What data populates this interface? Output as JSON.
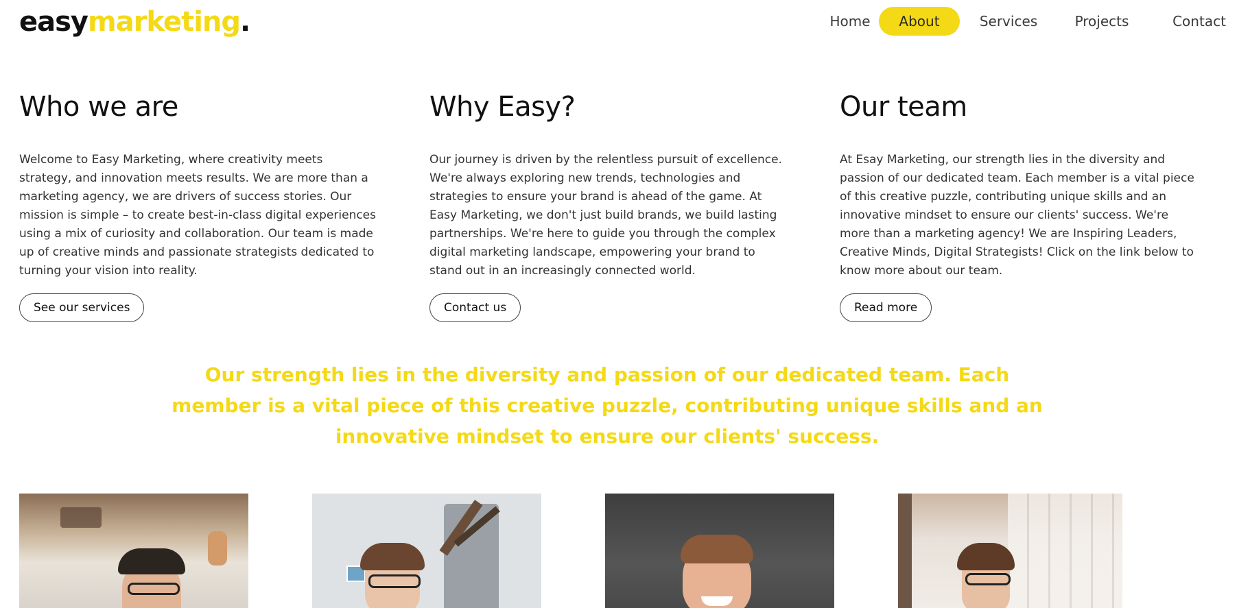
{
  "header": {
    "logo": {
      "part1": "easy",
      "part2": "marketing",
      "part3": "."
    },
    "nav": [
      {
        "label": "Home",
        "active": false
      },
      {
        "label": "About",
        "active": true
      },
      {
        "label": "Services",
        "active": false
      },
      {
        "label": "Projects",
        "active": false
      },
      {
        "label": "Contact",
        "active": false
      }
    ]
  },
  "columns": [
    {
      "title": "Who we are",
      "text": "Welcome to Easy Marketing, where creativity meets strategy, and innovation meets results. We are more than a marketing agency, we are drivers of success stories. Our mission is simple – to create best-in-class digital experiences using a mix of curiosity and collaboration. Our team is made up of creative minds and passionate strategists dedicated to turning your vision into reality.",
      "button": "See our services"
    },
    {
      "title": "Why Easy?",
      "text": "Our journey is driven by the relentless pursuit of excellence. We're always exploring new trends, technologies and strategies to ensure your brand is ahead of the game. At Easy Marketing, we don't just build brands, we build lasting partnerships. We're here to guide you through the complex digital marketing landscape, empowering your brand to stand out in an increasingly connected world.",
      "button": "Contact us"
    },
    {
      "title": "Our team",
      "text": "At Esay Marketing, our strength lies in the diversity and passion of our dedicated team. Each member is a vital piece of this creative puzzle, contributing unique skills and an innovative mindset to ensure our clients' success. We're more than a marketing agency! We are Inspiring Leaders, Creative Minds, Digital Strategists! Click on the link below to know more about our team.",
      "button": "Read more"
    }
  ],
  "quote": "Our strength lies in the diversity and passion of our dedicated team. Each member is a vital piece of this creative puzzle, contributing unique skills and an innovative mindset to ensure our clients' success.",
  "colors": {
    "accent": "#f4d916",
    "text": "#333333",
    "heading": "#111111"
  },
  "team_photos": [
    {
      "icon": "team-member-photo"
    },
    {
      "icon": "team-member-photo"
    },
    {
      "icon": "team-member-photo"
    },
    {
      "icon": "team-member-photo"
    }
  ]
}
